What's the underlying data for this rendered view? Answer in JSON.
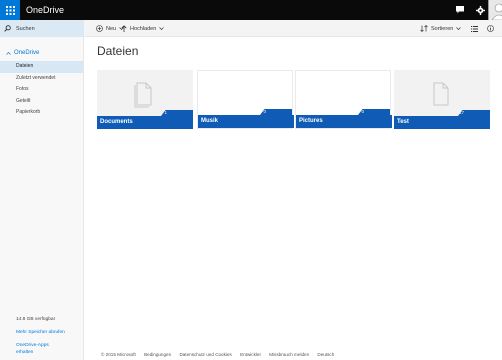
{
  "app": {
    "title": "OneDrive"
  },
  "search": {
    "label": "Suchen"
  },
  "commands": {
    "new": "Neu",
    "upload": "Hochladen",
    "sort": "Sortieren"
  },
  "sidebar": {
    "root": "OneDrive",
    "items": [
      {
        "label": "Dateien",
        "active": true
      },
      {
        "label": "Zuletzt verwendet"
      },
      {
        "label": "Fotos"
      },
      {
        "label": "Geteilt"
      },
      {
        "label": "Papierkorb"
      }
    ],
    "storage": "14.8 GB verfügbar",
    "more_storage": "Mehr Speicher abrufen",
    "apps": "OneDrive-Apps erhalten"
  },
  "main": {
    "title": "Dateien",
    "folders": [
      {
        "name": "Documents",
        "count": "1",
        "has_preview": true
      },
      {
        "name": "Musik",
        "count": "0",
        "has_preview": false
      },
      {
        "name": "Pictures",
        "count": "0",
        "has_preview": false
      },
      {
        "name": "Test",
        "count": "17",
        "has_preview": true
      }
    ]
  },
  "footer": {
    "links": [
      "© 2015 Microsoft",
      "Bedingungen",
      "Datenschutz und Cookies",
      "Entwickler",
      "Missbrauch melden",
      "Deutsch"
    ]
  },
  "colors": {
    "topbar": "#0a0a0a",
    "accent": "#0078d7",
    "tile_band": "#0f5bb5",
    "selected_nav": "#d6e7f6"
  }
}
